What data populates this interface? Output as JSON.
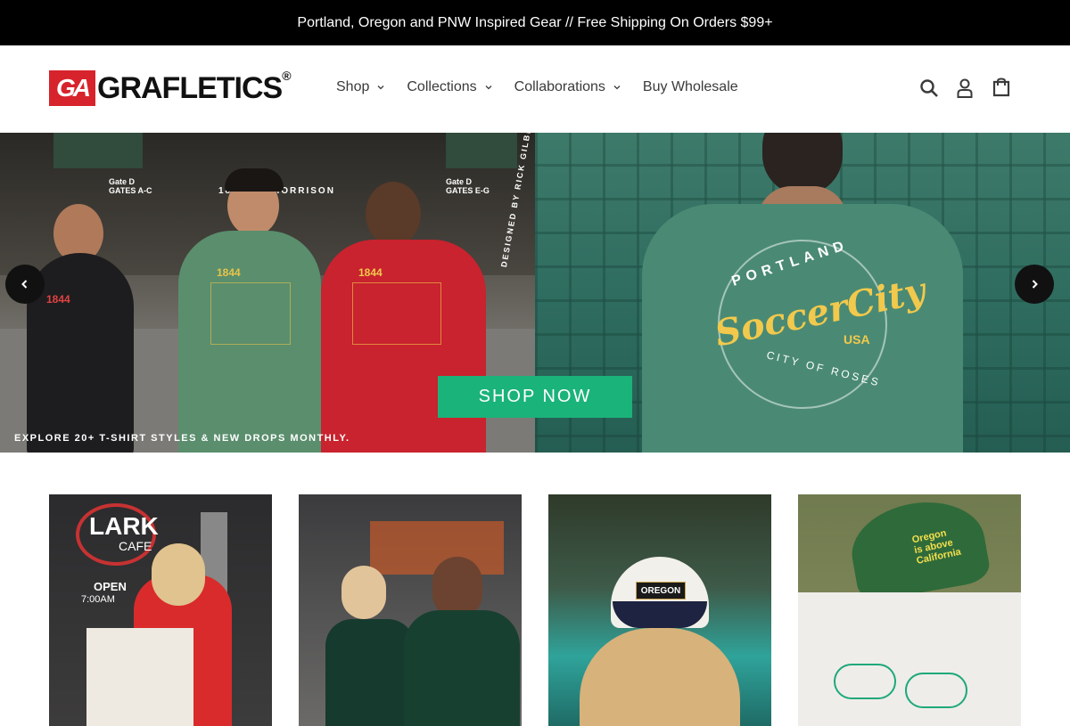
{
  "announcement": "Portland, Oregon and PNW Inspired Gear // Free Shipping On Orders $99+",
  "brand": {
    "logo_mark": "GA",
    "logo_word": "GRAFLETICS",
    "logo_reg": "®",
    "accent": "#d7232c"
  },
  "nav": {
    "items": [
      {
        "label": "Shop",
        "has_dropdown": true
      },
      {
        "label": "Collections",
        "has_dropdown": true
      },
      {
        "label": "Collaborations",
        "has_dropdown": true
      },
      {
        "label": "Buy Wholesale",
        "has_dropdown": false
      }
    ]
  },
  "header_icons": [
    "search-icon",
    "account-icon",
    "cart-icon"
  ],
  "hero": {
    "left_caption": "EXPLORE 20+ T-SHIRT STYLES & NEW DROPS MONTHLY.",
    "designed_by": "DESIGNED BY RICK GILBERT",
    "shirt_1844": "1844",
    "gate_left": "Gate D",
    "gate_left_sub": "GATES A-C",
    "gate_right": "Gate D",
    "gate_right_sub": "GATES E-G",
    "street": "1844 SW MORRISON",
    "right_portland": "PORTLAND",
    "right_soccer": "SoccerCity",
    "right_usa": "USA",
    "right_roses": "CITY OF ROSES",
    "cta_label": "SHOP NOW",
    "cta_color": "#1ab37a"
  },
  "product_cards": [
    {
      "image": "tote-bag-photo",
      "sign_text": "LARK",
      "sign_sub": "CAFE",
      "open_text": "OPEN",
      "time_text": "7:00AM"
    },
    {
      "image": "couple-tshirt-photo"
    },
    {
      "image": "oregon-cap-photo",
      "patch_text": "OREGON"
    },
    {
      "image": "trucker-hat-photo",
      "hat_text_1": "Oregon",
      "hat_text_2": "is above",
      "hat_text_3": "California"
    }
  ]
}
